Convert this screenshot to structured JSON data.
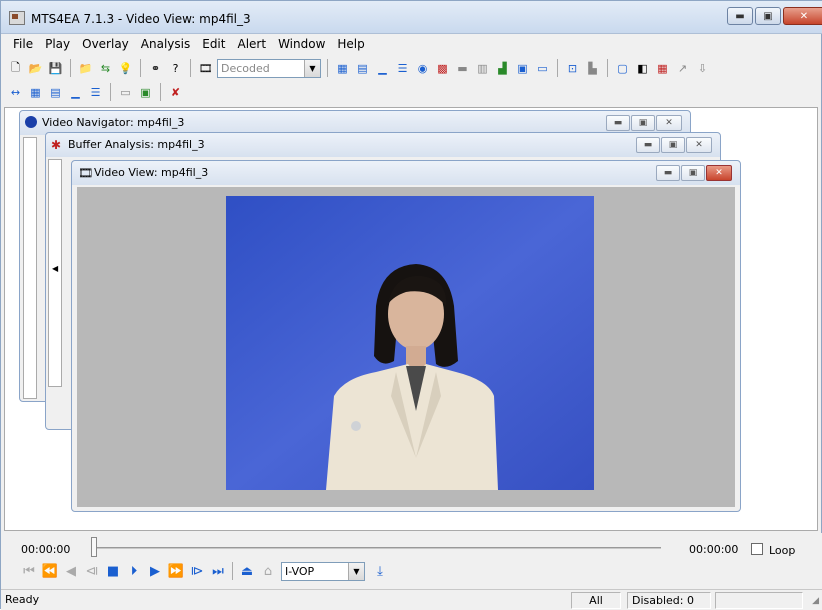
{
  "window": {
    "title": "MTS4EA 7.1.3 - Video View: mp4fil_3"
  },
  "menu": [
    "File",
    "Play",
    "Overlay",
    "Analysis",
    "Edit",
    "Alert",
    "Window",
    "Help"
  ],
  "toolbar": {
    "decode_select": "Decoded"
  },
  "children": {
    "navigator": {
      "title": "Video Navigator: mp4fil_3"
    },
    "buffer": {
      "title": "Buffer Analysis: mp4fil_3"
    },
    "video": {
      "title": "Video View: mp4fil_3"
    }
  },
  "playback": {
    "time_start": "00:00:00",
    "time_end": "00:00:00",
    "loop_label": "Loop",
    "frame_type": "I-VOP"
  },
  "status": {
    "ready": "Ready",
    "all": "All",
    "disabled": "Disabled: 0"
  },
  "colors": {
    "video_bg": "#3d55c5",
    "accent_blue": "#1a5fd0"
  }
}
